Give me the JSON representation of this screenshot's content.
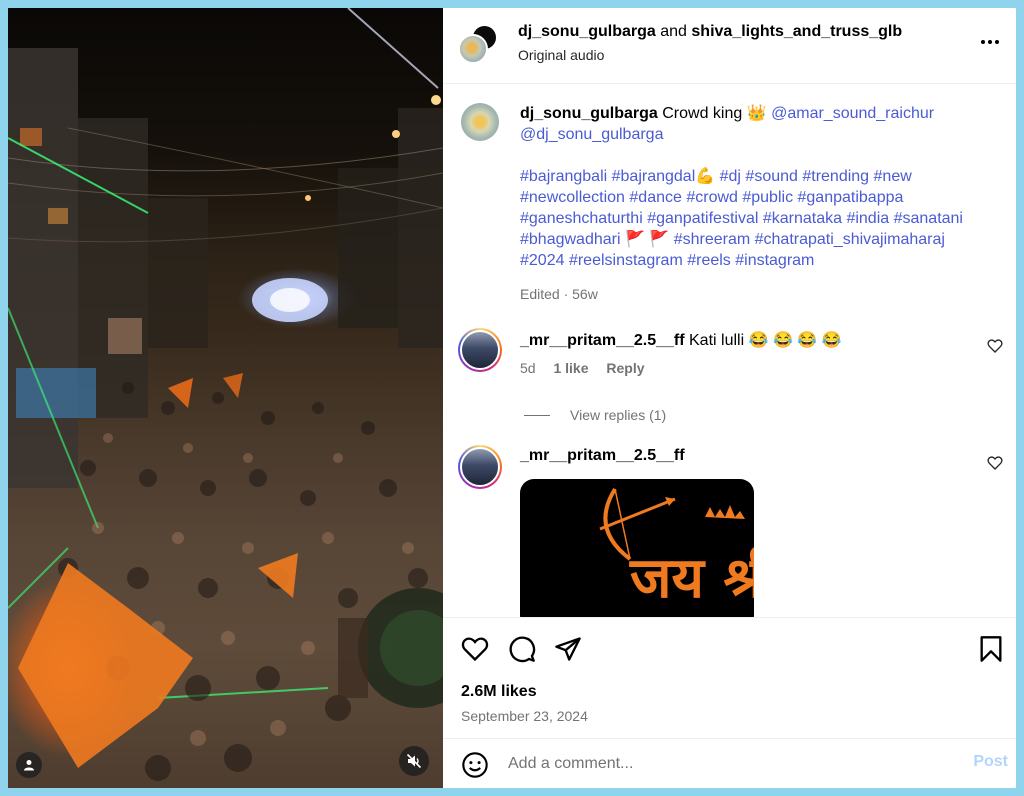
{
  "header": {
    "user1": "dj_sonu_gulbarga",
    "conjunction": " and ",
    "user2": "shiva_lights_and_truss_glb",
    "audio": "Original audio"
  },
  "caption": {
    "username": "dj_sonu_gulbarga",
    "text": " Crowd king 👑 ",
    "mention1": "@amar_sound_raichur",
    "mention2": "@dj_sonu_gulbarga",
    "hashtags_line1": "#bajrangbali #bajrangdal💪 #dj #sound #trending #new",
    "hashtags_line2": "#newcollection #dance #crowd #public #ganpatibappa",
    "hashtags_line3": "#ganeshchaturthi #ganpatifestival #karnataka #india #sanatani",
    "hashtags_line4": "#bhagwadhari 🚩 🚩 #shreeram #chatrapati_shivajimaharaj",
    "hashtags_line5": "#2024 #reelsinstagram #reels #instagram",
    "meta": "Edited · 56w"
  },
  "comments": [
    {
      "username": "_mr__pritam__2.5__ff",
      "text": " Kati lulli 😂 😂 😂 😂",
      "age": "5d",
      "likes": "1 like",
      "reply": "Reply"
    },
    {
      "username": "_mr__pritam__2.5__ff",
      "text": ""
    }
  ],
  "view_replies": "View replies (1)",
  "gif_text": "जय श्री राम",
  "engagement": {
    "likes": "2.6M likes",
    "date": "September 23, 2024"
  },
  "add_comment": {
    "placeholder": "Add a comment...",
    "post_label": "Post"
  },
  "icons": {
    "like": "heart-icon",
    "comment": "comment-icon",
    "share": "paper-plane-icon",
    "save": "bookmark-icon",
    "more": "more-horizontal-icon",
    "emoji": "emoji-icon",
    "mute": "muted-speaker-icon",
    "tag": "user-tag-icon"
  },
  "colors": {
    "link": "#4a5bd4",
    "post_disabled": "#b3d4fc",
    "saffron": "#f07a20"
  }
}
